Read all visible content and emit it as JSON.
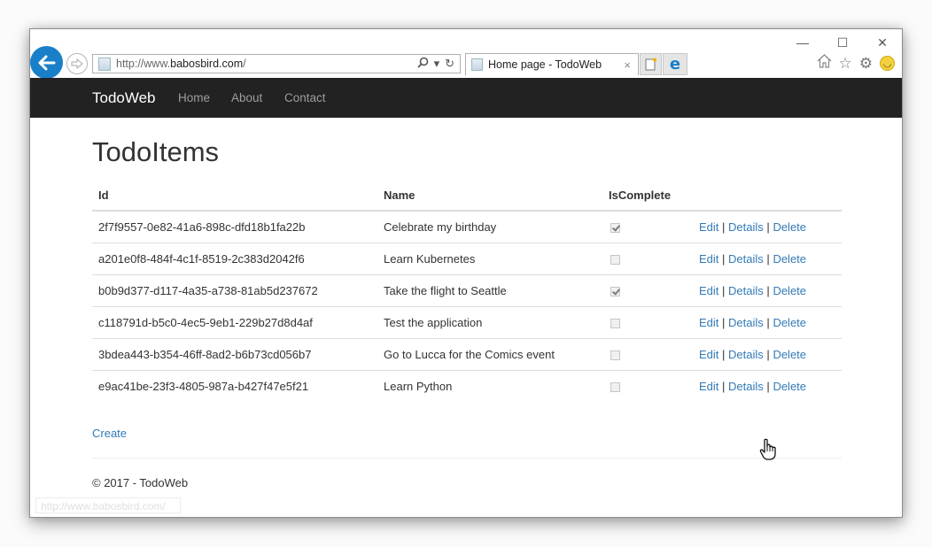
{
  "browser": {
    "address": {
      "scheme": "http://www.",
      "host": "babosbird.com",
      "path": "/"
    },
    "tab": {
      "title": "Home page - TodoWeb",
      "close_glyph": "×"
    },
    "window_controls": {
      "minimize": "—",
      "maximize": "☐",
      "close": "✕"
    },
    "icons": {
      "back": "←",
      "forward": "⇨",
      "search": "⚲",
      "dropdown": "▾",
      "refresh": "↻",
      "home": "⌂",
      "favorites": "☆",
      "settings": "⚙",
      "smiley": "◡",
      "edge": "e"
    },
    "status_url": "http://www.babosbird.com/"
  },
  "navbar": {
    "brand": "TodoWeb",
    "links": [
      "Home",
      "About",
      "Contact"
    ]
  },
  "page": {
    "title": "TodoItems",
    "columns": [
      "Id",
      "Name",
      "IsComplete",
      ""
    ],
    "rows": [
      {
        "id": "2f7f9557-0e82-41a6-898c-dfd18b1fa22b",
        "name": "Celebrate my birthday",
        "is_complete": true
      },
      {
        "id": "a201e0f8-484f-4c1f-8519-2c383d2042f6",
        "name": "Learn Kubernetes",
        "is_complete": false
      },
      {
        "id": "b0b9d377-d117-4a35-a738-81ab5d237672",
        "name": "Take the flight to Seattle",
        "is_complete": true
      },
      {
        "id": "c118791d-b5c0-4ec5-9eb1-229b27d8d4af",
        "name": "Test the application",
        "is_complete": false
      },
      {
        "id": "3bdea443-b354-46ff-8ad2-b6b73cd056b7",
        "name": "Go to Lucca for the Comics event",
        "is_complete": false
      },
      {
        "id": "e9ac41be-23f3-4805-987a-b427f47e5f21",
        "name": "Learn Python",
        "is_complete": false
      }
    ],
    "actions": {
      "edit": "Edit",
      "details": "Details",
      "delete": "Delete",
      "separator": "|"
    },
    "create_label": "Create",
    "footer": "© 2017 - TodoWeb"
  },
  "colors": {
    "navbar": "#222222",
    "link": "#337ab7",
    "back_button": "#1a7fc9"
  }
}
